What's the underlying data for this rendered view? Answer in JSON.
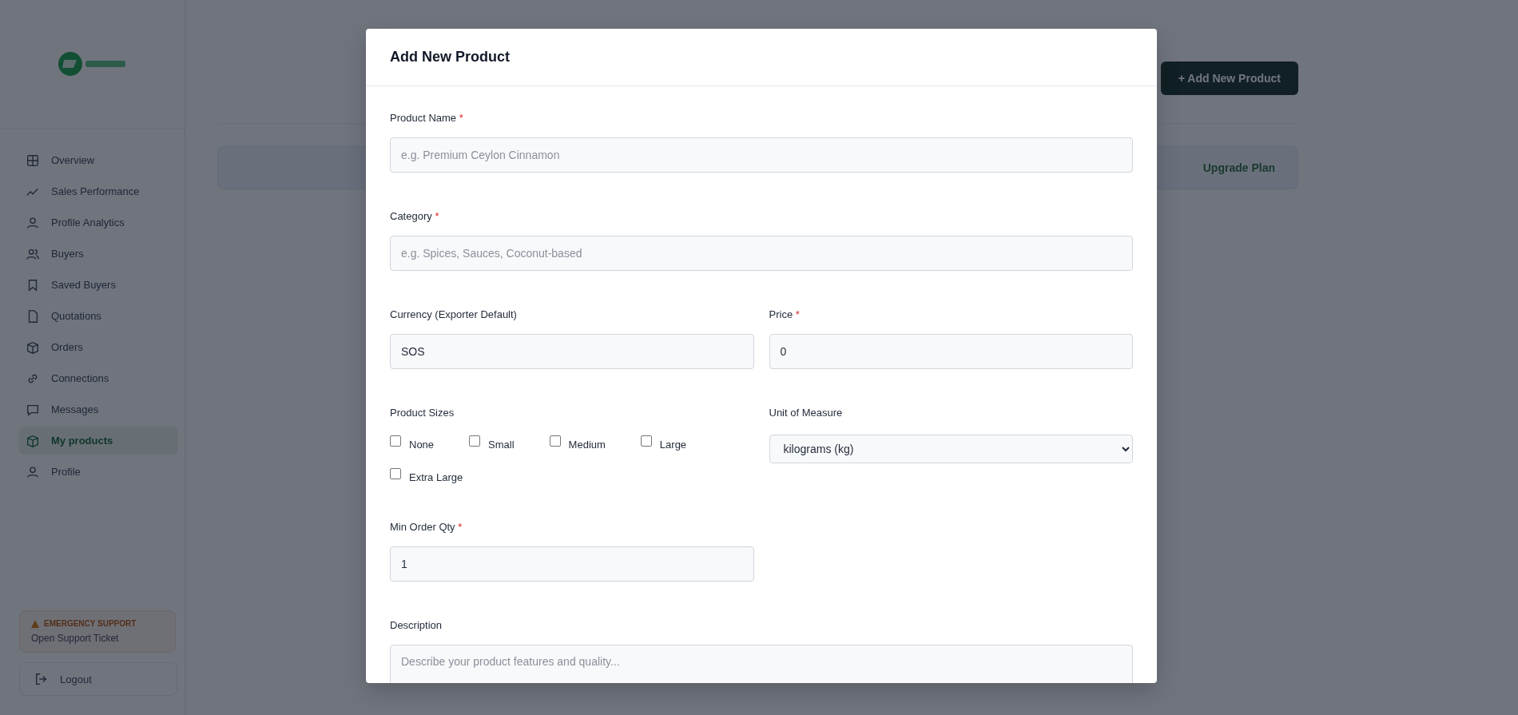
{
  "sidebar": {
    "items": [
      {
        "label": "Overview",
        "selected": false
      },
      {
        "label": "Sales Performance",
        "selected": false
      },
      {
        "label": "Profile Analytics",
        "selected": false
      },
      {
        "label": "Buyers",
        "selected": false
      },
      {
        "label": "Saved Buyers",
        "selected": false
      },
      {
        "label": "Quotations",
        "selected": false
      },
      {
        "label": "Orders",
        "selected": false
      },
      {
        "label": "Connections",
        "selected": false
      },
      {
        "label": "Messages",
        "selected": false
      },
      {
        "label": "My products",
        "selected": true
      },
      {
        "label": "Profile",
        "selected": false
      }
    ],
    "support": {
      "title": "EMERGENCY SUPPORT",
      "link": "Open Support Ticket"
    },
    "logout": "Logout"
  },
  "main": {
    "add_button": "+ Add New Product",
    "upgrade_button": "Upgrade Plan"
  },
  "modal": {
    "title": "Add New Product",
    "rows": [
      [
        {
          "kind": "text",
          "label": "Product Name",
          "required_mark": "*",
          "placeholder": "e.g. Premium Ceylon Cinnamon"
        }
      ],
      [
        {
          "kind": "text",
          "label": "Category",
          "required_mark": "*",
          "placeholder": "e.g. Spices, Sauces, Coconut-based"
        }
      ],
      [
        {
          "kind": "text",
          "label": "Currency (Exporter Default)",
          "value": "SOS"
        },
        {
          "kind": "text",
          "label": "Price",
          "required_mark": "*",
          "value": "0"
        }
      ],
      [
        {
          "kind": "checkboxes",
          "label": "Product Sizes",
          "options": [
            {
              "label": "None",
              "checked": false
            },
            {
              "label": "Small",
              "checked": false
            },
            {
              "label": "Medium",
              "checked": false
            },
            {
              "label": "Large",
              "checked": false
            },
            {
              "label": "Extra Large",
              "checked": false
            }
          ]
        },
        {
          "kind": "select",
          "label": "Unit of Measure",
          "value": "kilograms (kg)"
        }
      ],
      [
        {
          "kind": "text",
          "label": "Min Order Qty",
          "required_mark": "*",
          "value": "1"
        },
        {
          "kind": "empty"
        }
      ],
      [
        {
          "kind": "textarea",
          "label": "Description",
          "placeholder": "Describe your product features and quality..."
        }
      ]
    ]
  }
}
